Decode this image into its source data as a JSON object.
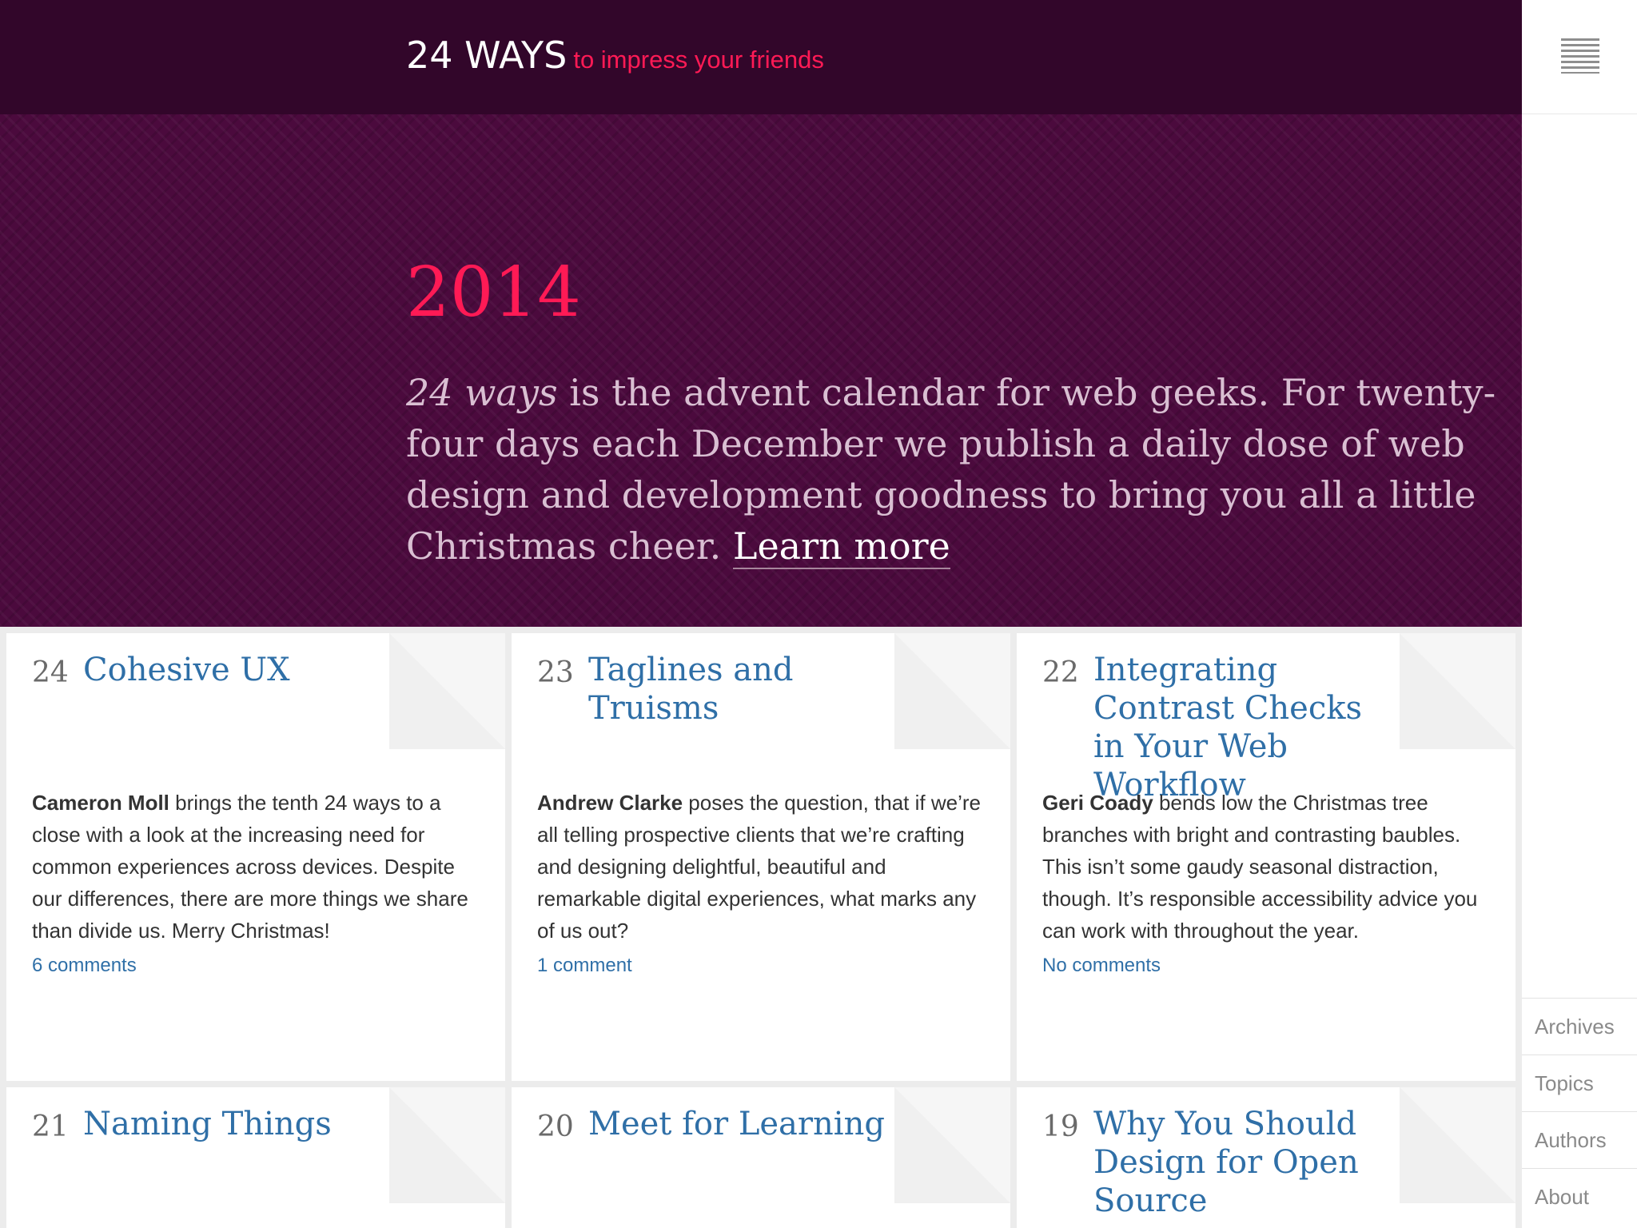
{
  "header": {
    "logo_main": "24 WAYS",
    "logo_tagline": "to impress your friends"
  },
  "sidebar": {
    "menu_icon": "hamburger-menu-icon",
    "items": [
      {
        "label": "Archives"
      },
      {
        "label": "Topics"
      },
      {
        "label": "Authors"
      },
      {
        "label": "About"
      }
    ]
  },
  "hero": {
    "year": "2014",
    "intro_em": "24 ways",
    "intro_text": " is the advent calendar for web geeks. For twenty-four days each December we publish a daily dose of web design and development goodness to bring you all a little Christmas cheer. ",
    "learn_more": "Learn more"
  },
  "articles": [
    {
      "number": "24",
      "title": "Cohesive UX",
      "author": "Cameron Moll",
      "summary": " brings the tenth 24 ways to a close with a look at the increasing need for common experiences across devices. Despite our differences, there are more things we share than divide us. Merry Christmas!",
      "comments": "6 comments"
    },
    {
      "number": "23",
      "title": "Taglines and Truisms",
      "author": "Andrew Clarke",
      "summary": " poses the question, that if we’re all telling prospective clients that we’re crafting and designing delightful, beautiful and remarkable digital experiences, what marks any of us out?",
      "comments": "1 comment"
    },
    {
      "number": "22",
      "title": "Integrating Contrast Checks in Your Web Workflow",
      "author": "Geri Coady",
      "summary": " bends low the Christmas tree branches with bright and contrasting baubles. This isn’t some gaudy seasonal distraction, though. It’s responsible accessibility advice you can work with throughout the year.",
      "comments": "No comments"
    },
    {
      "number": "21",
      "title": "Naming Things"
    },
    {
      "number": "20",
      "title": "Meet for Learning"
    },
    {
      "number": "19",
      "title": "Why You Should Design for Open Source"
    }
  ],
  "colors": {
    "header_bg": "#32062a",
    "hero_bg": "#4b0a3d",
    "accent": "#ff1a55",
    "link": "#2f6fa7"
  }
}
